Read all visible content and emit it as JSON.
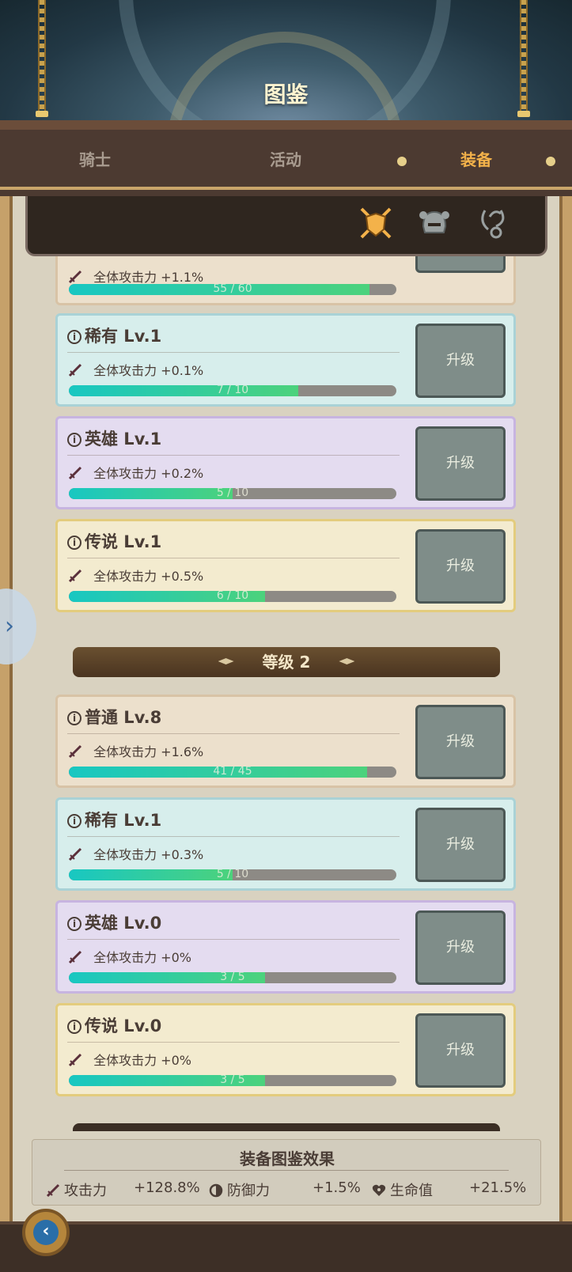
{
  "header": {
    "title": "图鉴"
  },
  "tabs": [
    {
      "label": "骑士"
    },
    {
      "label": "活动"
    },
    {
      "label": "装备",
      "active": true
    }
  ],
  "filters": [
    "shield-swords-icon",
    "helmet-icon",
    "necklace-icon"
  ],
  "upgrade_label": "升级",
  "cards": [
    {
      "title": "",
      "stat": "全体攻击力 +1.1%",
      "progress_text": "55 / 60",
      "progress": 0.917,
      "rarity": "normal"
    },
    {
      "title": "稀有 Lv.1",
      "stat": "全体攻击力 +0.1%",
      "progress_text": "7 / 10",
      "progress": 0.7,
      "rarity": "rare"
    },
    {
      "title": "英雄 Lv.1",
      "stat": "全体攻击力 +0.2%",
      "progress_text": "5 / 10",
      "progress": 0.5,
      "rarity": "hero"
    },
    {
      "title": "传说 Lv.1",
      "stat": "全体攻击力 +0.5%",
      "progress_text": "6 / 10",
      "progress": 0.6,
      "rarity": "legend"
    }
  ],
  "section": {
    "label": "等级 2"
  },
  "cards2": [
    {
      "title": "普通 Lv.8",
      "stat": "全体攻击力 +1.6%",
      "progress_text": "41 / 45",
      "progress": 0.911,
      "rarity": "normal"
    },
    {
      "title": "稀有 Lv.1",
      "stat": "全体攻击力 +0.3%",
      "progress_text": "5 / 10",
      "progress": 0.5,
      "rarity": "rare"
    },
    {
      "title": "英雄 Lv.0",
      "stat": "全体攻击力 +0%",
      "progress_text": "3 / 5",
      "progress": 0.6,
      "rarity": "hero"
    },
    {
      "title": "传说 Lv.0",
      "stat": "全体攻击力 +0%",
      "progress_text": "3 / 5",
      "progress": 0.6,
      "rarity": "legend"
    }
  ],
  "summary": {
    "title": "装备图鉴效果",
    "attack_label": "攻击力",
    "attack_value": "+128.8%",
    "defense_label": "防御力",
    "defense_value": "+1.5%",
    "hp_label": "生命值",
    "hp_value": "+21.5%"
  },
  "colors": {
    "accent": "#f3b24a",
    "button": "#7f8d89",
    "bar_start": "#18c7c2",
    "bar_end": "#4cd27c"
  }
}
